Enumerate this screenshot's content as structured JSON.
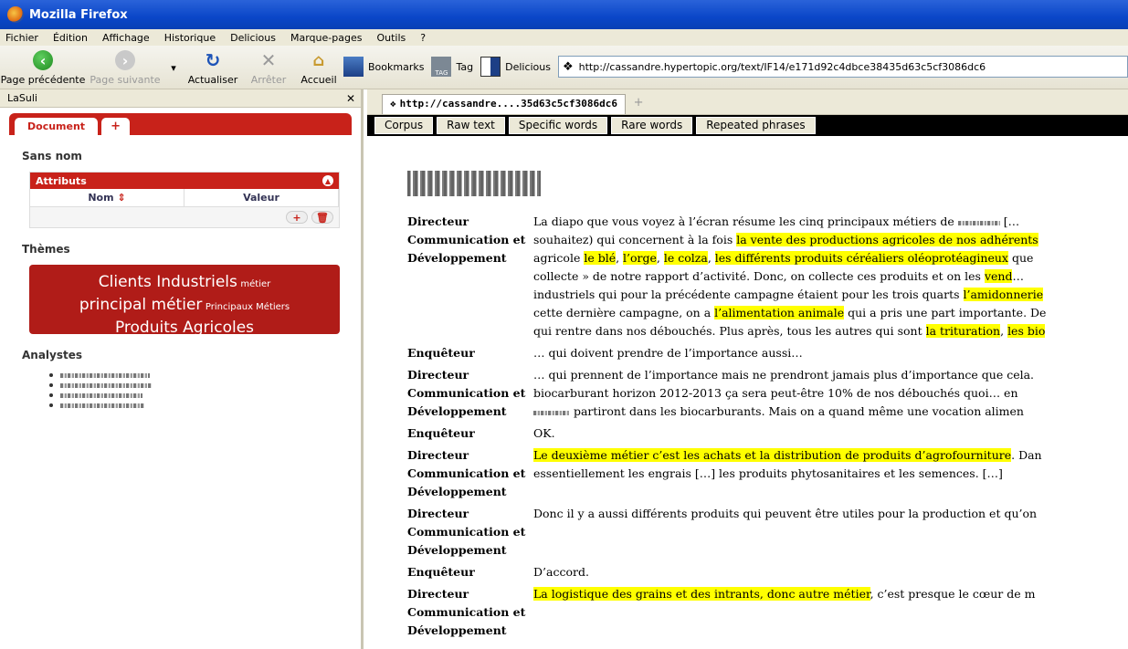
{
  "window": {
    "title": "Mozilla Firefox"
  },
  "menu": [
    "Fichier",
    "Édition",
    "Affichage",
    "Historique",
    "Delicious",
    "Marque-pages",
    "Outils",
    "?"
  ],
  "toolbar": {
    "back": "Page précédente",
    "forward": "Page suivante",
    "reload": "Actualiser",
    "stop": "Arrêter",
    "home": "Accueil",
    "bookmarks": "Bookmarks",
    "tag": "Tag",
    "delicious": "Delicious",
    "url": "http://cassandre.hypertopic.org/text/IF14/e171d92c4dbce38435d63c5cf3086dc6"
  },
  "sidebar": {
    "title": "LaSuli",
    "tabs": [
      "Document",
      "+"
    ],
    "doc_name": "Sans nom",
    "attributes": {
      "title": "Attributs",
      "col_name": "Nom",
      "col_value": "Valeur"
    },
    "themes_title": "Thèmes",
    "tag_cloud": [
      {
        "text": "Clients Industriels",
        "size": "big"
      },
      {
        "text": "métier",
        "size": "small"
      },
      {
        "text": "principal métier",
        "size": "big"
      },
      {
        "text": "Principaux Métiers",
        "size": "small"
      },
      {
        "text": "Produits Agricoles",
        "size": "big"
      }
    ],
    "analysts_title": "Analystes"
  },
  "content": {
    "tab_label": "http://cassandre....35d63c5cf3086dc6",
    "view_buttons": [
      "Corpus",
      "Raw text",
      "Specific words",
      "Rare words",
      "Repeated phrases"
    ],
    "speakers": {
      "dir": "Directeur Communication et Développement",
      "enq": "Enquêteur"
    },
    "lines": {
      "r1a": "La diapo que vous voyez à l’écran résume les cinq principaux métiers de ",
      "r1a2": " […",
      "r1b1": "souhaitez) qui concernent à la fois ",
      "r1b_hl": "la vente des productions agricoles de nos adhérents",
      "r1c1": "agricole ",
      "r1c_hl1": "le blé",
      "r1c_sep1": ", ",
      "r1c_hl2": "l’orge",
      "r1c_sep2": ", ",
      "r1c_hl3": "le colza",
      "r1c_sep3": ", ",
      "r1c_hl4": "les différents produits céréaliers oléoprotéagineux",
      "r1c_end": " que",
      "r1d1": "collecte » de notre rapport d’activité. Donc, on collecte ces produits et on les ",
      "r1d_hl": "vend",
      "r1d_end": "…",
      "r1e1": "industriels qui pour la précédente campagne étaient pour les trois quarts ",
      "r1e_hl": "l’amidonnerie",
      "r1f1": "cette dernière campagne, on a ",
      "r1f_hl": "l’alimentation animale",
      "r1f_end": " qui a pris une part importante. De",
      "r1g1": "qui rentre dans nos débouchés. Plus après, tous les autres qui sont ",
      "r1g_hl1": "la trituration",
      "r1g_sep": ", ",
      "r1g_hl2": "les bio",
      "r2": "… qui doivent prendre de l’importance aussi…",
      "r3a": "… qui prennent de l’importance mais ne prendront jamais plus d’importance que cela.",
      "r3b": "biocarburant horizon 2012-2013 ça sera peut-être 10% de nos débouchés quoi… en",
      "r3c": " partiront dans les biocarburants. Mais on a quand même une vocation alimen",
      "r4": "OK.",
      "r5_hl": "Le deuxième métier c’est les achats et la distribution de produits d’agrofourniture",
      "r5a_end": ". Dan",
      "r5b": "essentiellement les engrais […] les produits phytosanitaires et les semences. […]",
      "r6": "Donc il y a aussi différents produits qui peuvent être utiles pour la production et qu’on",
      "r7": "D’accord.",
      "r8_hl": "La logistique des grains et des intrants, donc autre métier",
      "r8_end": ", c’est presque le cœur de m"
    }
  }
}
